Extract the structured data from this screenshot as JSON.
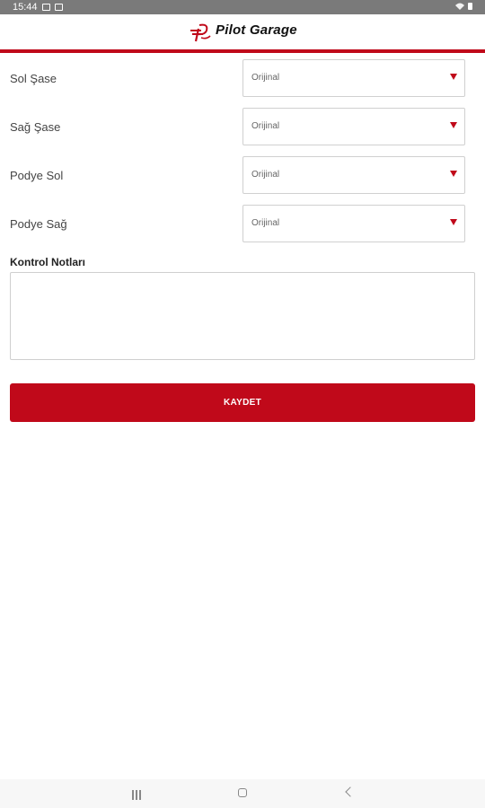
{
  "status_bar": {
    "time": "15:44",
    "right_icons": "wifi battery"
  },
  "header": {
    "logo_text": "Pilot Garage",
    "accent_color": "#c0091a"
  },
  "form": {
    "rows": [
      {
        "label": "Sol Şase",
        "value": "Orijinal"
      },
      {
        "label": "Sağ Şase",
        "value": "Orijinal"
      },
      {
        "label": "Podye Sol",
        "value": "Orijinal"
      },
      {
        "label": "Podye Sağ",
        "value": "Orijinal"
      }
    ],
    "notes_label": "Kontrol Notları",
    "notes_value": "",
    "save_label": "KAYDET"
  },
  "nav": {
    "recents_icon": "recents-icon",
    "home_icon": "home-icon",
    "back_icon": "back-icon"
  }
}
